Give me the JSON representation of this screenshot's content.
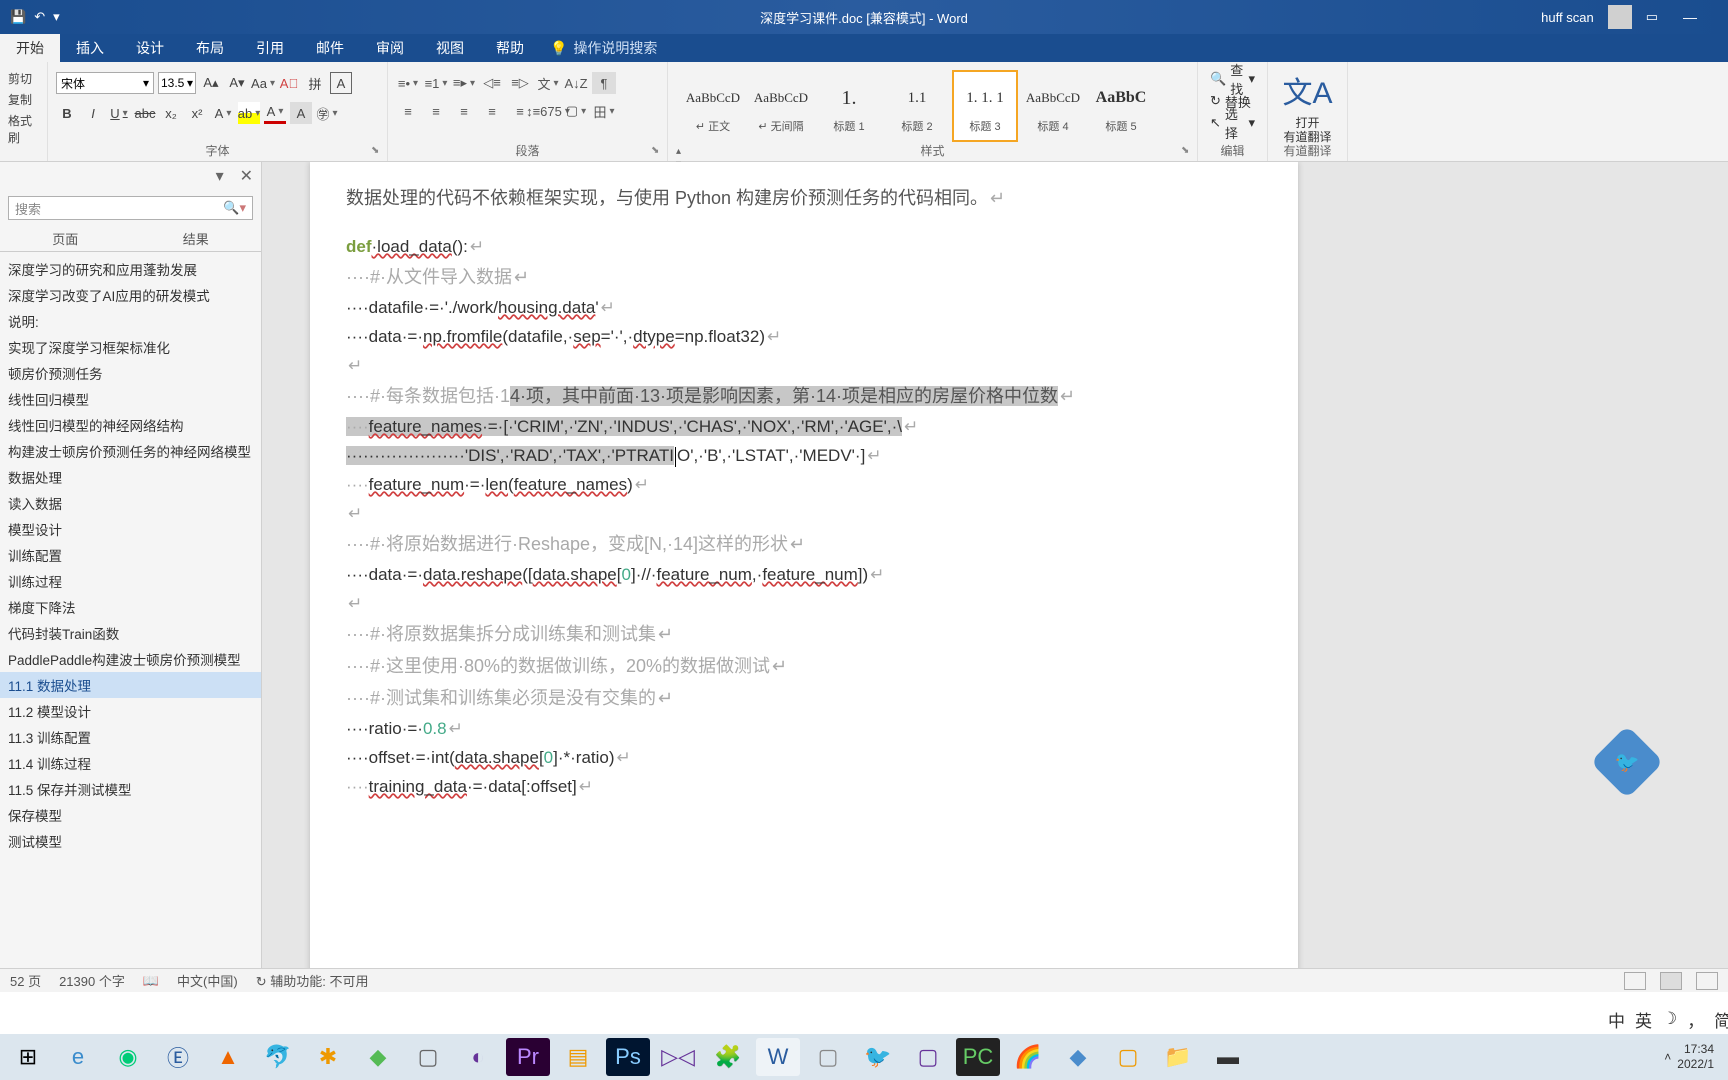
{
  "titlebar": {
    "title": "深度学习课件.doc [兼容模式] - Word",
    "user": "huff scan"
  },
  "tabs": {
    "start": "开始",
    "insert": "插入",
    "design": "设计",
    "layout": "布局",
    "refs": "引用",
    "mail": "邮件",
    "review": "审阅",
    "view": "视图",
    "help": "帮助",
    "tellme": "操作说明搜索"
  },
  "ribbon": {
    "clip": {
      "cut": "剪切",
      "copy": "复制",
      "brush": "格式刷"
    },
    "font": {
      "name": "宋体",
      "size": "13.5",
      "label": "字体"
    },
    "para": {
      "label": "段落"
    },
    "styles": {
      "label": "样式",
      "items": [
        {
          "preview": "AaBbCcD",
          "name": "↵ 正文"
        },
        {
          "preview": "AaBbCcD",
          "name": "↵ 无间隔"
        },
        {
          "preview": "1.",
          "name": "标题 1"
        },
        {
          "preview": "1.1",
          "name": "标题 2"
        },
        {
          "preview": "1. 1. 1",
          "name": "标题 3"
        },
        {
          "preview": "AaBbCcD",
          "name": "标题 4"
        },
        {
          "preview": "AaBbC",
          "name": "标题 5"
        }
      ]
    },
    "edit": {
      "find": "查找",
      "replace": "替换",
      "select": "选择",
      "label": "编辑"
    },
    "trans": {
      "open": "打开",
      "name": "有道翻译",
      "label": "有道翻译"
    }
  },
  "nav": {
    "search_ph": "搜索",
    "tab_pages": "页面",
    "tab_results": "结果",
    "items": [
      {
        "t": "深度学习的研究和应用蓬勃发展",
        "lv": 1
      },
      {
        "t": "深度学习改变了AI应用的研发模式",
        "lv": 1
      },
      {
        "t": "说明:",
        "lv": 1
      },
      {
        "t": "实现了深度学习框架标准化",
        "lv": 1
      },
      {
        "t": "顿房价预测任务",
        "lv": 1
      },
      {
        "t": "线性回归模型",
        "lv": 1
      },
      {
        "t": "线性回归模型的神经网络结构",
        "lv": 1
      },
      {
        "t": "构建波士顿房价预测任务的神经网络模型",
        "lv": 1
      },
      {
        "t": "数据处理",
        "lv": 1
      },
      {
        "t": "读入数据",
        "lv": 1
      },
      {
        "t": "模型设计",
        "lv": 1
      },
      {
        "t": "训练配置",
        "lv": 1
      },
      {
        "t": "训练过程",
        "lv": 1
      },
      {
        "t": "梯度下降法",
        "lv": 1
      },
      {
        "t": "代码封装Train函数",
        "lv": 1
      },
      {
        "t": "  PaddlePaddle构建波士顿房价预测模型",
        "lv": 1
      },
      {
        "t": "11.1 数据处理",
        "lv": 2,
        "sel": true
      },
      {
        "t": "11.2 模型设计",
        "lv": 2
      },
      {
        "t": "11.3 训练配置",
        "lv": 2
      },
      {
        "t": "11.4 训练过程",
        "lv": 2
      },
      {
        "t": "11.5 保存并测试模型",
        "lv": 2
      },
      {
        "t": "保存模型",
        "lv": 2
      },
      {
        "t": "测试模型",
        "lv": 2
      }
    ]
  },
  "doc": {
    "intro": "数据处理的代码不依赖框架实现，与使用 Python 构建房价预测任务的代码相同。",
    "l1a": "def",
    "l1b": "·load_data",
    "l1c": "():",
    "l2": "····#·从文件导入数据",
    "l3a": "····datafile·=·'./work/",
    "l3b": "housing.data",
    "l3c": "'",
    "l4a": "····data·=·",
    "l4b": "np.fromfile",
    "l4c": "(datafile,·",
    "l4d": "sep",
    "l4e": "='·',·",
    "l4f": "dtype",
    "l4g": "=np.float32)",
    "l6a": "····#·每条数据包括·1",
    "l6b": "4·项，其中前面·13·项是影响因素，第·14·项是相应的房屋价格中位数",
    "l7a": "····",
    "l7b": "feature_names",
    "l7c": "·=·[·'CRIM',·'ZN',·'INDUS',·'CHAS',·'NOX',·'RM',·'AGE',·\\",
    "l8": "·····················'DIS',·'RAD',·'TAX',·'PTRATI",
    "l8b": "O',·'B',·'LSTAT',·'MEDV'·]",
    "l9a": "····",
    "l9b": "feature_num",
    "l9c": "·=·",
    "l9d": "len",
    "l9e": "(",
    "l9f": "feature_names",
    "l9g": ")",
    "l11": "····#·将原始数据进行·Reshape，变成[N,·14]这样的形状",
    "l12a": "····data·=·",
    "l12b": "data.reshape",
    "l12c": "([",
    "l12d": "data.shape",
    "l12e": "[",
    "l12f": "0",
    "l12g": "]·//·",
    "l12h": "feature_num",
    "l12i": ",·",
    "l12j": "feature_num",
    "l12k": "])",
    "l14": "····#·将原数据集拆分成训练集和测试集",
    "l15": "····#·这里使用·80%的数据做训练，20%的数据做测试",
    "l16": "····#·测试集和训练集必须是没有交集的",
    "l17a": "····ratio·=·",
    "l17b": "0.8",
    "l18a": "····offset·=·int(",
    "l18b": "data.shape",
    "l18c": "[",
    "l18d": "0",
    "l18e": "]·*·ratio)",
    "l19a": "····",
    "l19b": "training_data",
    "l19c": "·=·data[:offset]"
  },
  "status": {
    "page": "52 页",
    "words": "21390 个字",
    "lang": "中文(中国)",
    "a11y": "辅助功能: 不可用"
  },
  "ime": {
    "ch": "中",
    "en": "英",
    "full": "简"
  },
  "tray": {
    "time": "17:34",
    "date": "2022/1"
  }
}
